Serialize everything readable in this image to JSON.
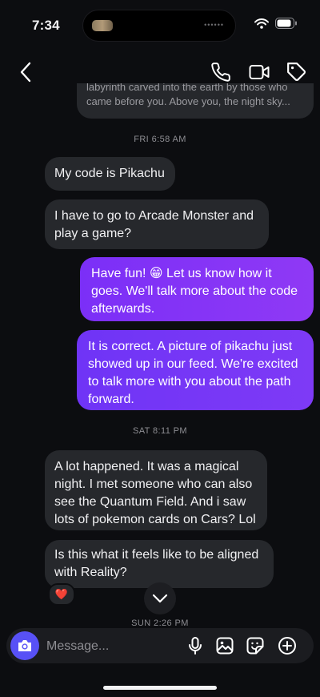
{
  "status": {
    "time": "7:34"
  },
  "nav": {
    "icons": [
      "chevron-left-icon",
      "phone-icon",
      "video-icon",
      "tag-icon"
    ]
  },
  "messages": {
    "prev_fragment": {
      "line1": "labyrinth carved into the earth by those who",
      "line2": "came before you. Above you, the night sky..."
    },
    "stamp_fri": "FRI 6:58 AM",
    "m1": "My code is Pikachu",
    "m2": "I have to go to Arcade Monster and play a game?",
    "m3": "Have fun! 😁 Let us know how it goes. We'll talk more about the code afterwards.",
    "m4": "It is correct. A picture of pikachu just showed up in our feed. We're excited to talk more with you about the path forward.",
    "stamp_sat": "SAT 8:11 PM",
    "m5": "A lot happened. It was a magical night. I met someone who can also see the Quantum Field. And i saw lots of pokemon cards on Cars? Lol",
    "m6": "Is this what it feels like to be aligned with Reality?",
    "reaction": "❤️",
    "stamp_sun": "SUN 2:26 PM"
  },
  "composer": {
    "placeholder": "Message...",
    "icons": [
      "camera-icon",
      "microphone-icon",
      "image-icon",
      "sticker-icon",
      "plus-icon"
    ]
  },
  "colors": {
    "background": "#0c0d10",
    "incoming_bubble": "#26282c",
    "outgoing_bubble": "#7b2ff7",
    "camera_button": "#5851f6"
  }
}
